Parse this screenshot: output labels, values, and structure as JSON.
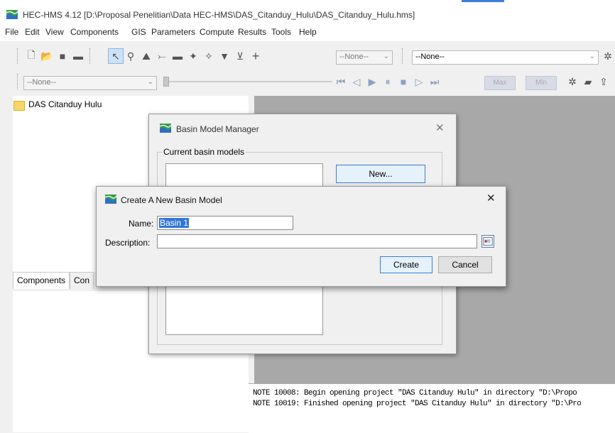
{
  "window": {
    "title": "HEC-HMS 4.12 [D:\\Proposal Penelitian\\Data HEC-HMS\\DAS_Citanduy_Hulu\\DAS_Citanduy_Hulu.hms]"
  },
  "menu": {
    "items": [
      "File",
      "Edit",
      "View",
      "Components",
      "GIS",
      "Parameters",
      "Compute",
      "Results",
      "Tools",
      "Help"
    ]
  },
  "toolbar": {
    "combo1": "--None--",
    "combo2": "--None--",
    "combo3": "--None--",
    "max_label": "Max",
    "min_label": "Min",
    "icons": [
      "new-icon",
      "open-icon",
      "save-icon",
      "print-icon",
      "pointer-icon",
      "zoom-icon",
      "subbasin-icon",
      "reach-icon",
      "reservoir-icon",
      "junction-icon",
      "diversion-icon",
      "source-icon",
      "sink-icon",
      "add-icon"
    ],
    "player_icons": [
      "skip-start-icon",
      "step-back-icon",
      "play-icon",
      "pause-icon",
      "stop-icon",
      "step-forward-icon",
      "skip-end-icon"
    ]
  },
  "tree": {
    "root": "DAS Citanduy Hulu"
  },
  "tabs": [
    "Components",
    "Con"
  ],
  "console": {
    "lines": [
      "NOTE 10008:  Begin opening project \"DAS Citanduy Hulu\" in directory \"D:\\Propo",
      "NOTE 10019:  Finished opening project \"DAS Citanduy Hulu\" in directory \"D:\\Pro"
    ]
  },
  "basin_manager": {
    "title": "Basin Model Manager",
    "group_label": "Current basin models",
    "new_button": "New..."
  },
  "create_dialog": {
    "title": "Create A New Basin Model",
    "name_label": "Name:",
    "name_value": "Basin 1",
    "description_label": "Description:",
    "description_value": "",
    "create_button": "Create",
    "cancel_button": "Cancel"
  },
  "colors": {
    "accent": "#3c7fd6",
    "map_area": "#a8a8a8",
    "selection": "#3376d6"
  }
}
